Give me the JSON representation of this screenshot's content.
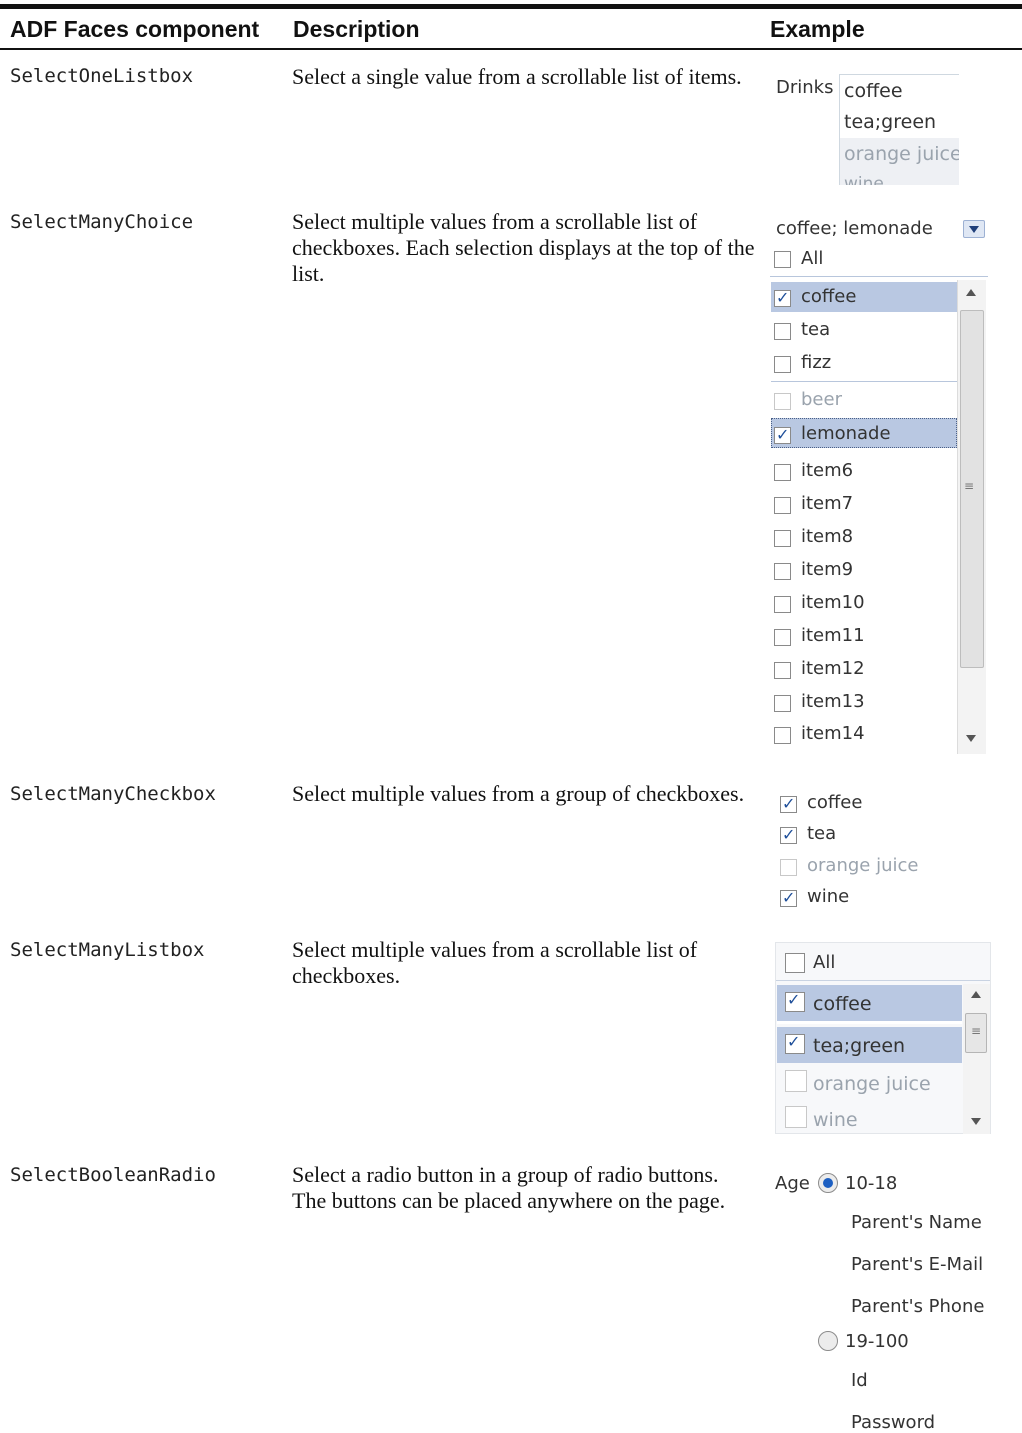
{
  "header": {
    "component": "ADF Faces component",
    "description": "Description",
    "example": "Example"
  },
  "rows": [
    {
      "component": "SelectOneListbox",
      "description": "Select a single value from a scrollable list of items.",
      "example": {
        "label": "Drinks",
        "options": [
          "coffee",
          "tea;green",
          "orange juice",
          "wine"
        ]
      }
    },
    {
      "component": "SelectManyChoice",
      "description": "Select multiple values from a scrollable list of checkboxes. Each selection displays at the top of the list.",
      "example": {
        "value": "coffee; lemonade",
        "all_label": "All",
        "items": [
          {
            "label": "coffee",
            "checked": true
          },
          {
            "label": "tea",
            "checked": false
          },
          {
            "label": "fizz",
            "checked": false
          },
          {
            "label": "beer",
            "checked": false
          },
          {
            "label": "lemonade",
            "checked": true
          },
          {
            "label": "item6",
            "checked": false
          },
          {
            "label": "item7",
            "checked": false
          },
          {
            "label": "item8",
            "checked": false
          },
          {
            "label": "item9",
            "checked": false
          },
          {
            "label": "item10",
            "checked": false
          },
          {
            "label": "item11",
            "checked": false
          },
          {
            "label": "item12",
            "checked": false
          },
          {
            "label": "item13",
            "checked": false
          },
          {
            "label": "item14",
            "checked": false
          }
        ]
      }
    },
    {
      "component": "SelectManyCheckbox",
      "description": "Select multiple values from a group of checkboxes.",
      "example": {
        "items": [
          {
            "label": "coffee",
            "checked": true
          },
          {
            "label": "tea",
            "checked": true
          },
          {
            "label": "orange juice",
            "checked": false
          },
          {
            "label": "wine",
            "checked": true
          }
        ]
      }
    },
    {
      "component": "SelectManyListbox",
      "description": "Select multiple values from a scrollable list of checkboxes.",
      "example": {
        "all_label": "All",
        "items": [
          {
            "label": "coffee",
            "checked": true
          },
          {
            "label": "tea;green",
            "checked": true
          },
          {
            "label": "orange juice",
            "checked": false
          },
          {
            "label": "wine",
            "checked": false
          }
        ]
      }
    },
    {
      "component": "SelectBooleanRadio",
      "description": "Select a radio button in a group of radio buttons. The buttons can be placed anywhere on the page.",
      "example": {
        "label": "Age",
        "option1": "10-18",
        "option1_fields": [
          "Parent's Name",
          "Parent's E-Mail",
          "Parent's Phone"
        ],
        "option2": "19-100",
        "option2_fields": [
          "Id",
          "Password"
        ]
      }
    }
  ],
  "colors": {
    "selection": "#b9c8e2",
    "rule": "#111111",
    "radio_on": "#1c5fc2"
  },
  "icons": [
    "checkbox-icon",
    "dropdown-arrow-icon",
    "scroll-up-icon",
    "scroll-down-icon",
    "radio-icon"
  ]
}
